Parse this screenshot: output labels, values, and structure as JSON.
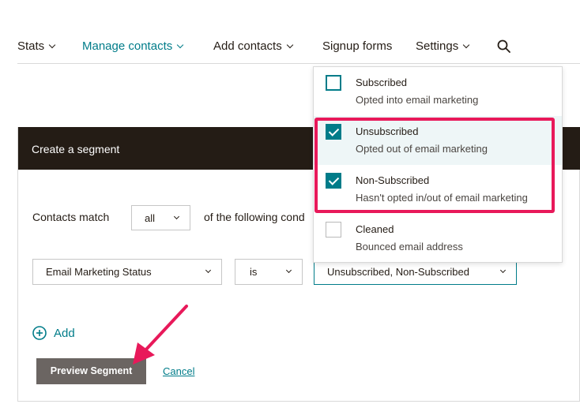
{
  "nav": {
    "items": [
      {
        "label": "Stats",
        "has_dropdown": true
      },
      {
        "label": "Manage contacts",
        "has_dropdown": true,
        "active": true
      },
      {
        "label": "Add contacts",
        "has_dropdown": true
      },
      {
        "label": "Signup forms",
        "has_dropdown": false
      },
      {
        "label": "Settings",
        "has_dropdown": true
      }
    ],
    "search_icon": "search-icon"
  },
  "segment": {
    "title": "Create a segment",
    "match_label": "Contacts match",
    "match_value": "all",
    "following_text": "of the following cond",
    "condition": {
      "field": "Email Marketing Status",
      "operator": "is",
      "value": "Unsubscribed, Non-Subscribed"
    },
    "add_label": "Add",
    "preview_label": "Preview Segment",
    "cancel_label": "Cancel"
  },
  "dropdown": {
    "options": [
      {
        "title": "Subscribed",
        "subtitle": "Opted into email marketing",
        "checked": false
      },
      {
        "title": "Unsubscribed",
        "subtitle": "Opted out of email marketing",
        "checked": true
      },
      {
        "title": "Non-Subscribed",
        "subtitle": "Hasn't opted in/out of email marketing",
        "checked": true
      },
      {
        "title": "Cleaned",
        "subtitle": "Bounced email address",
        "checked": false
      }
    ]
  },
  "colors": {
    "accent": "#007c89",
    "header_bg": "#241c15",
    "annotation": "#e8195a",
    "button_bg": "#6b6562"
  }
}
